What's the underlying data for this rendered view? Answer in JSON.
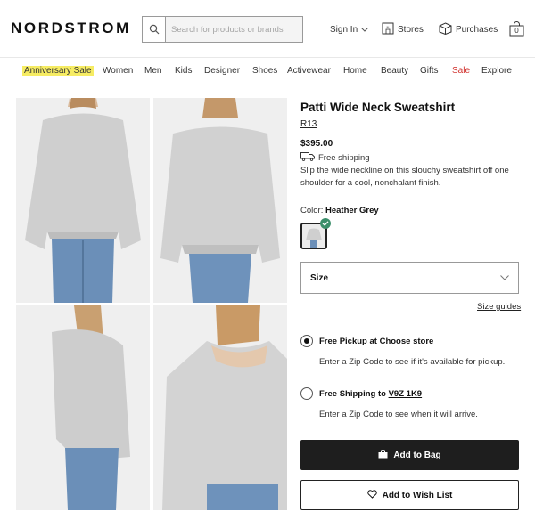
{
  "header": {
    "logo": "NORDSTROM",
    "search_placeholder": "Search for products or brands",
    "sign_in": "Sign In",
    "stores": "Stores",
    "purchases": "Purchases",
    "bag_count": "0"
  },
  "nav": {
    "items": [
      "Anniversary Sale",
      "Women",
      "Men",
      "Kids",
      "Designer",
      "Shoes",
      "Activewear",
      "Home",
      "Beauty",
      "Gifts",
      "Sale",
      "Explore"
    ]
  },
  "product": {
    "title": "Patti Wide Neck Sweatshirt",
    "brand": "R13",
    "price": "$395.00",
    "shipping_note": "Free shipping",
    "description": "Slip the wide neckline on this slouchy sweatshirt off one shoulder for a cool, nonchalant finish.",
    "color_label": "Color:",
    "color_value": "Heather Grey",
    "size_label": "Size",
    "size_guides": "Size guides"
  },
  "fulfillment": {
    "pickup_label": "Free Pickup at",
    "pickup_link": "Choose store",
    "pickup_sub": "Enter a Zip Code to see if it's available for pickup.",
    "ship_label": "Free Shipping to",
    "ship_link": "V9Z 1K9",
    "ship_sub": "Enter a Zip Code to see when it will arrive."
  },
  "actions": {
    "add_to_bag": "Add to Bag",
    "add_to_wishlist": "Add to Wish List"
  },
  "colors": {
    "nav_highlight": "#f6ec63",
    "sale": "#d0302c",
    "check": "#3b8f6b",
    "button_dark": "#1e1e1e"
  }
}
